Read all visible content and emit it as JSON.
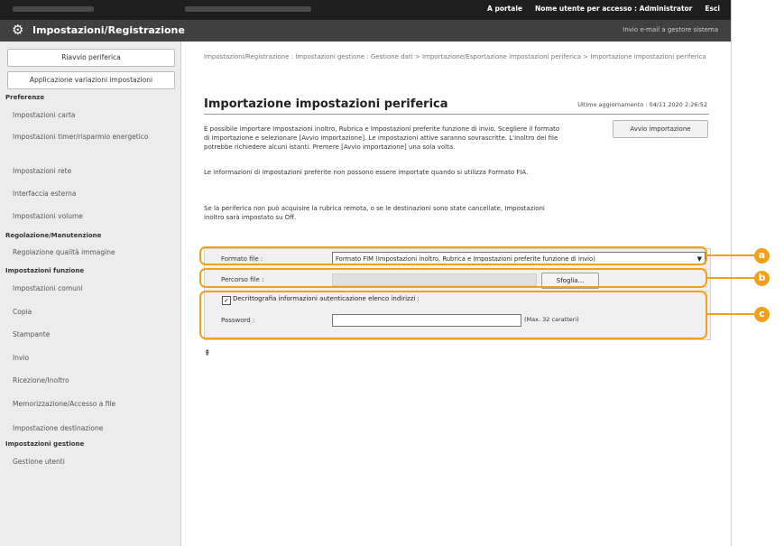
{
  "topbar": {
    "portal_link": "A portale",
    "login_user_label": "Nome utente per accesso : Administrator",
    "logout_link": "Esci"
  },
  "titlebar": {
    "title": "Impostazioni/Registrazione",
    "mail_link": "Invio e-mail a gestore sistema"
  },
  "sidebar": {
    "restart_button": "Riavvio periferica",
    "apply_button": "Applicazione variazioni impostazioni",
    "categories": [
      {
        "label": "Preferenze",
        "items": [
          "Impostazioni carta",
          "Impostazioni timer/risparmio energetico",
          "Impostazioni rete",
          "Interfaccia esterna",
          "Impostazioni volume"
        ]
      },
      {
        "label": "Regolazione/Manutenzione",
        "items": [
          "Regolazione qualità immagine"
        ]
      },
      {
        "label": "Impostazioni funzione",
        "items": [
          "Impostazioni comuni",
          "Copia",
          "Stampante",
          "Invio",
          "Ricezione/Inoltro",
          "Memorizzazione/Accesso a file",
          "Impostazione destinazione"
        ]
      },
      {
        "label": "Impostazioni gestione",
        "items": [
          "Gestione utenti"
        ]
      }
    ]
  },
  "main": {
    "breadcrumb": "Impostazioni/Registrazione : Impostazioni gestione : Gestione dati > Importazione/Esportazione impostazioni periferica > Importazione impostazioni periferica",
    "page_title": "Importazione impostazioni periferica",
    "last_updated": "Ultimo aggiornamento : 04/11 2020 2:26:52",
    "start_button": "Avvio importazione",
    "desc1": "È possibile importare Impostazioni inoltro, Rubrica e Impostazioni preferite funzione di invio. Scegliere il formato di importazione e selezionare [Avvio importazione]. Le impostazioni attive saranno sovrascritte. L'inoltro del file potrebbe richiedere alcuni istanti. Premere [Avvio importazione] una sola volta.",
    "desc2": "Le informazioni di impostazioni preferite non possono essere importate quando si utilizza Formato FIA.",
    "desc3": "Se la periferica non può acquisire la rubrica remota, o se le destinazioni sono state cancellate, Impostazioni inoltro sarà impostato su Off.",
    "form": {
      "file_format_label": "Formato file :",
      "file_format_value": "Formato FIM (Impostazioni inoltro, Rubrica e Impostazioni preferite funzione di invio)",
      "file_path_label": "Percorso file :",
      "browse_button": "Sfoglia...",
      "decrypt_label": "Decrittografia informazioni autenticazione elenco indirizzi :",
      "decrypt_checked": true,
      "password_label": "Password :",
      "password_value": "",
      "max_chars": "(Max. 32 caratteri)"
    },
    "to_top": "⇞"
  },
  "callouts": [
    "a",
    "b",
    "c"
  ],
  "colors": {
    "accent": "#f0a11c"
  }
}
